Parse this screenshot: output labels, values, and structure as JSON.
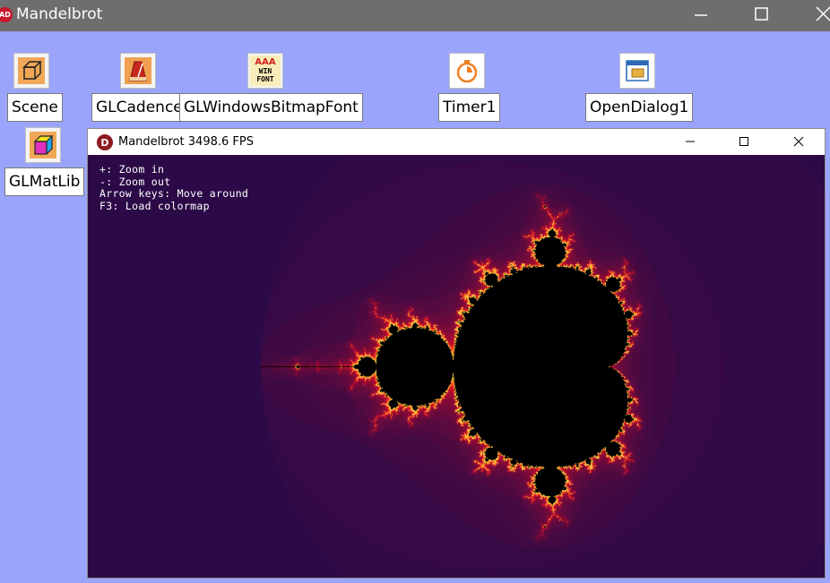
{
  "outer": {
    "title": "Mandelbrot",
    "icon_text": "AD"
  },
  "components": {
    "scene": "Scene",
    "cadencer": "GLCadencer",
    "bitmapfont": "GLWindowsBitmapFont",
    "bitmapfont_icon": [
      "AAA",
      "WIN",
      "FONT"
    ],
    "timer": "Timer1",
    "opendialog": "OpenDialog1",
    "matlib": "GLMatLib"
  },
  "inner": {
    "title": "Mandelbrot 3498.6 FPS",
    "icon_text": "D",
    "help": [
      "+: Zoom in",
      "-: Zoom out",
      "Arrow keys: Move around",
      "F3: Load colormap"
    ]
  },
  "colors": {
    "background": "#9ba4fb",
    "outer_titlebar": "#6e6e6e",
    "fractal_bg": "#2a0a4a"
  },
  "icons": [
    "cube-icon",
    "metronome-icon",
    "font-icon",
    "stopwatch-icon",
    "folder-dialog-icon",
    "material-cube-icon"
  ]
}
